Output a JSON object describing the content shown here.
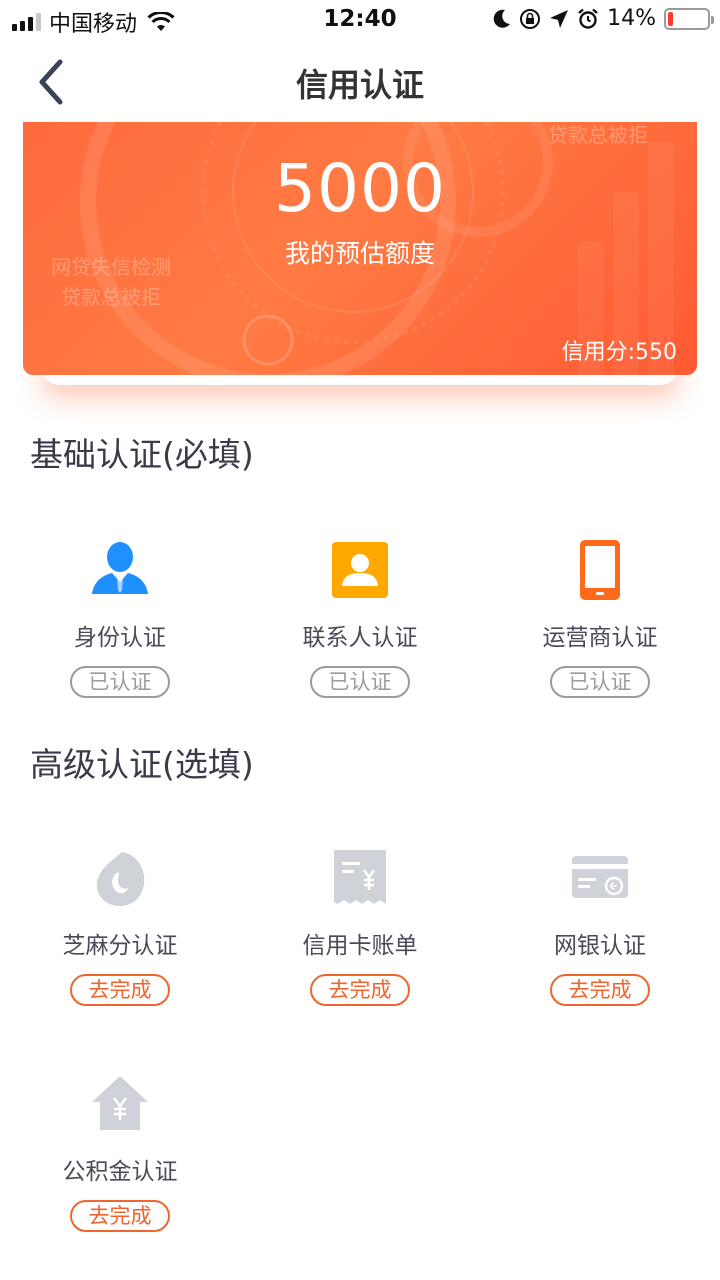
{
  "status_bar": {
    "carrier": "中国移动",
    "time": "12:40",
    "battery_percent": "14%",
    "battery_level": 0.14,
    "icons": [
      "signal-icon",
      "wifi-icon",
      "moon-icon",
      "lock-rotation-icon",
      "location-arrow-icon",
      "alarm-icon",
      "battery-icon"
    ]
  },
  "nav": {
    "title": "信用认证",
    "back_icon": "chevron-left-icon"
  },
  "banner": {
    "amount": "5000",
    "amount_label": "我的预估额度",
    "credit_score": "信用分:550",
    "bg_texts": [
      "网贷失信检测",
      "贷款总被拒",
      "贷款总被拒"
    ],
    "gradient_colors": [
      "#ff6a3d",
      "#ff5a33"
    ]
  },
  "basic_section": {
    "title": "基础认证(必填)",
    "items": [
      {
        "label": "身份认证",
        "status": "已认证",
        "icon": "person-icon",
        "icon_color": "#1e90ff"
      },
      {
        "label": "联系人认证",
        "status": "已认证",
        "icon": "contact-card-icon",
        "icon_color": "#ffa800"
      },
      {
        "label": "运营商认证",
        "status": "已认证",
        "icon": "phone-icon",
        "icon_color": "#ff6a1a"
      }
    ]
  },
  "advanced_section": {
    "title": "高级认证(选填)",
    "items": [
      {
        "label": "芝麻分认证",
        "status": "去完成",
        "icon": "sesame-icon"
      },
      {
        "label": "信用卡账单",
        "status": "去完成",
        "icon": "receipt-icon"
      },
      {
        "label": "网银认证",
        "status": "去完成",
        "icon": "bank-card-icon"
      },
      {
        "label": "公积金认证",
        "status": "去完成",
        "icon": "house-yuan-icon"
      }
    ]
  },
  "colors": {
    "accent": "#f0652e",
    "done_gray": "#9a9aa0",
    "disabled_icon": "#cfd2d8"
  }
}
